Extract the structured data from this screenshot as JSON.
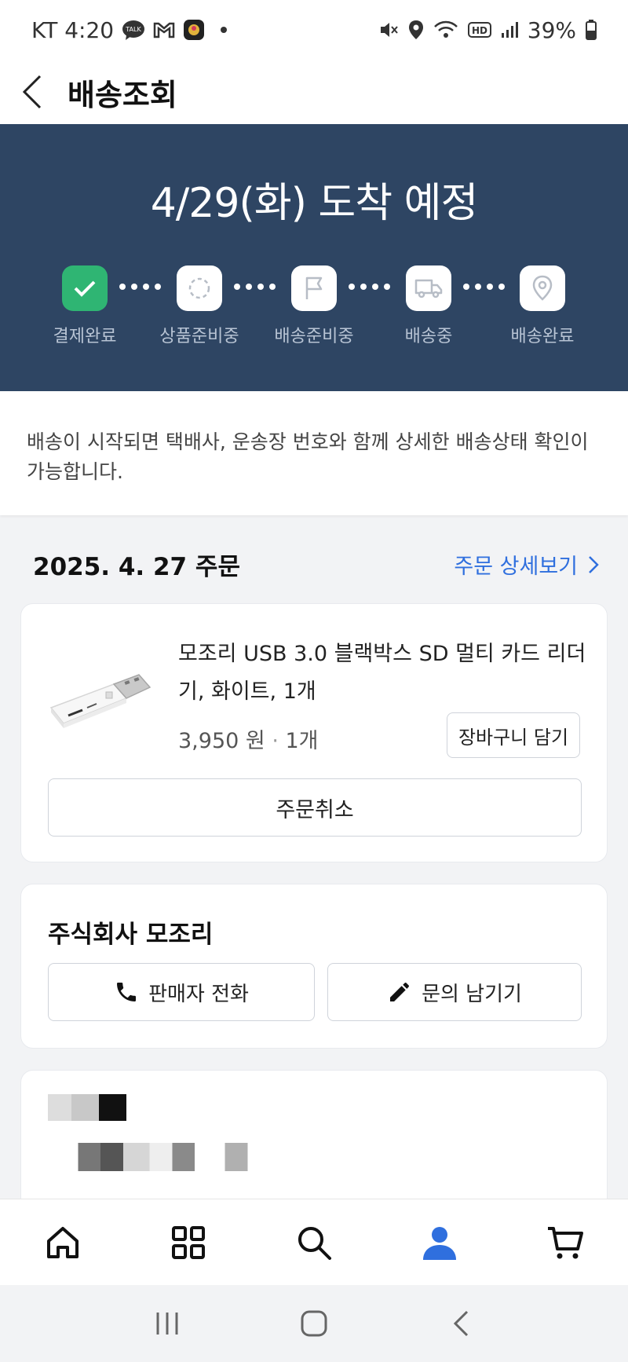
{
  "status_bar": {
    "carrier_time": "KT 4:20",
    "battery": "39%"
  },
  "header": {
    "title": "배송조회"
  },
  "hero": {
    "eta": "4/29(화) 도착 예정",
    "steps": [
      {
        "label": "결제완료",
        "done": true
      },
      {
        "label": "상품준비중",
        "done": false
      },
      {
        "label": "배송준비중",
        "done": false
      },
      {
        "label": "배송중",
        "done": false
      },
      {
        "label": "배송완료",
        "done": false
      }
    ]
  },
  "notice": {
    "text": "배송이 시작되면 택배사, 운송장 번호와 함께 상세한 배송상태 확인이 가능합니다."
  },
  "order": {
    "date": "2025. 4. 27 주문",
    "detail_link": "주문 상세보기",
    "product": {
      "name": "모조리 USB 3.0 블랙박스 SD 멀티 카드 리더기, 화이트, 1개",
      "price": "3,950 원",
      "quantity": "1개",
      "add_to_cart": "장바구니 담기"
    },
    "cancel": "주문취소"
  },
  "seller": {
    "name": "주식회사 모조리",
    "call": "판매자 전화",
    "inquiry": "문의 남기기"
  },
  "bottom_nav": {
    "items": [
      "home-icon",
      "category-icon",
      "search-icon",
      "my-page-icon",
      "cart-icon"
    ],
    "active": "my-page-icon"
  },
  "colors": {
    "hero_bg": "#2e4563",
    "done_green": "#2fb573",
    "link_blue": "#2f6fde",
    "active_nav": "#2f6fde"
  }
}
